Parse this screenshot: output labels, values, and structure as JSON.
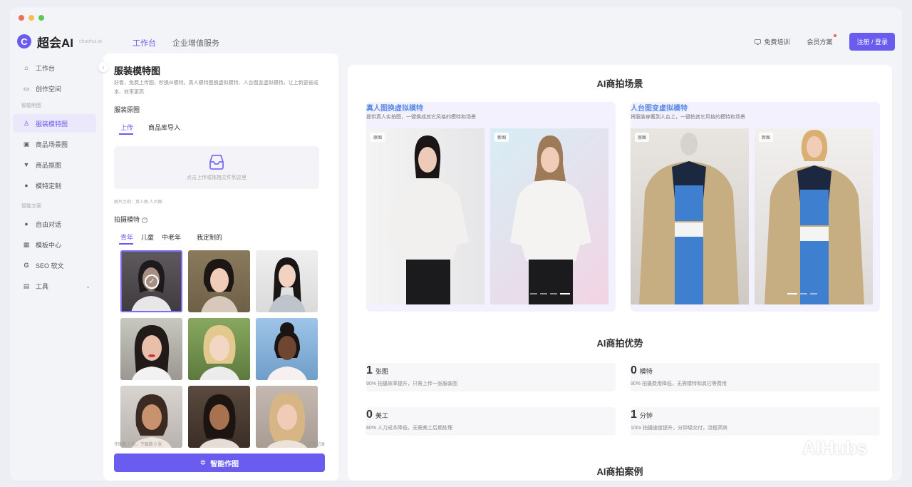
{
  "window": {
    "dots": [
      "#f26b5b",
      "#f6be4f",
      "#5bc85a"
    ]
  },
  "brand": {
    "mark": "C",
    "name": "超会AI",
    "tagline": "chaohui.ai"
  },
  "nav": {
    "tabs": [
      "工作台",
      "企业增值服务"
    ],
    "active_tab": 0,
    "free_training": "免费培训",
    "plans": "会员方案",
    "login": "注册 / 登录"
  },
  "sidebar": {
    "top_items": [
      {
        "label": "工作台",
        "icon": "home-icon"
      },
      {
        "label": "创作空间",
        "icon": "folder-icon"
      }
    ],
    "group1": "智能制图",
    "group1_items": [
      {
        "label": "服装模特图",
        "icon": "shirt-icon",
        "active": true
      },
      {
        "label": "商品场景图",
        "icon": "image-icon"
      },
      {
        "label": "商品抠图",
        "icon": "cutout-icon"
      },
      {
        "label": "模特定制",
        "icon": "person-icon"
      }
    ],
    "group2": "智能文案",
    "group2_items": [
      {
        "label": "自由对话",
        "icon": "chat-icon"
      },
      {
        "label": "模板中心",
        "icon": "grid-icon"
      },
      {
        "label": "SEO 软文",
        "icon": "seo-icon"
      },
      {
        "label": "工具",
        "icon": "tool-icon"
      }
    ]
  },
  "left_panel": {
    "title": "服装模特图",
    "description": "好看、免费上传图，秒换AI模特，真人模特图换虚拟模特、人台图变虚拟模特，让上新更省成本、效率更高",
    "garment_label": "服装原图",
    "upload_tabs": [
      "上传",
      "商品库导入"
    ],
    "upload_hint": "点击上传或拖拽文件到这里",
    "upload_examples": "图片示例：真人图 人台图",
    "model_label": "拍摄模特",
    "model_tabs": [
      "青年",
      "儿童",
      "中老年",
      "我定制的"
    ],
    "footer_left": "作图数 0 张，下载数 0 张",
    "footer_right": "作图记录",
    "generate": "智能作图"
  },
  "right_panel": {
    "scene_title": "AI商拍场景",
    "cards": [
      {
        "title": "真人图换虚拟模特",
        "desc": "提供真人实拍图，一键换成其它风格的模特和场景",
        "before": "原图",
        "after": "新图"
      },
      {
        "title": "人台图变虚拟模特",
        "desc": "将服装穿戴到人台上，一键拍其它风格的模特和场景",
        "before": "原图",
        "after": "新图"
      }
    ],
    "advantage_title": "AI商拍优势",
    "advantages": [
      {
        "num": "1",
        "unit": "张图",
        "desc": "90% 拍摄效率提升，只需上传一张服装图"
      },
      {
        "num": "0",
        "unit": "模特",
        "desc": "90% 拍摄费用降低，无需模特和其它等费用"
      },
      {
        "num": "0",
        "unit": "美工",
        "desc": "80% 人力成本降低，无需美工后期处理"
      },
      {
        "num": "1",
        "unit": "分钟",
        "desc": "100x 拍摄速度提升，分钟级交付，流程高效"
      }
    ],
    "case_title": "AI商拍案例"
  },
  "watermark": "AIHubs",
  "colors": {
    "accent": "#6b5cf0",
    "card_title": "#5b8be8"
  }
}
